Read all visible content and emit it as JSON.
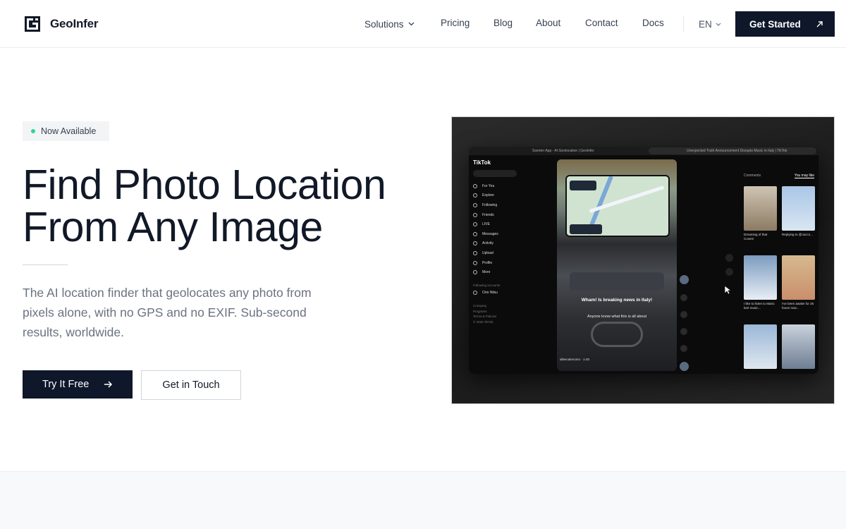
{
  "brand": {
    "name": "GeoInfer"
  },
  "nav": {
    "links": [
      {
        "label": "Solutions",
        "has_menu": true
      },
      {
        "label": "Pricing"
      },
      {
        "label": "Blog"
      },
      {
        "label": "About"
      },
      {
        "label": "Contact"
      },
      {
        "label": "Docs"
      }
    ],
    "language": "EN",
    "cta_label": "Get Started"
  },
  "hero": {
    "badge": "Now Available",
    "title_line1": "Find Photo Location",
    "title_line2": "From Any Image",
    "subtitle": "The AI location finder that geolocates any photo from pixels alone, with no GPS and no EXIF. Sub-second results, worldwide.",
    "primary_label": "Try It Free",
    "secondary_label": "Get in Touch"
  },
  "screenshot": {
    "tab1": "Ssenter App - AI Geolocation | GeoInfer",
    "tab2": "Unexpected Truth Announcement Disrupts Music in Italy | TikTok",
    "logo": "TikTok",
    "sidebar": [
      "For You",
      "Explore",
      "Following",
      "Friends",
      "LIVE",
      "Messages",
      "Activity",
      "Upload",
      "Profile",
      "More"
    ],
    "following_label": "Following accounts",
    "following_user": "Orio Nilsu",
    "footer_links": [
      "Company",
      "Programs",
      "Terms & Policies",
      "© 2025 TikTok"
    ],
    "caption_main": "Wham! Is breaking news in Italy!",
    "caption_sub": "Anyone know what this is all about",
    "video_user": "alleecalenomo · 1-20",
    "panel_tabs": [
      "Comments",
      "You may like"
    ],
    "thumb_captions": [
      "Dreaming of that Coven!",
      "Replying to @Jucco...",
      "I like to listen to Mario kart music...",
      "I've been awake for 26 hours now..."
    ],
    "colors": {
      "accent_dark": "#0f172a",
      "badge_dot": "#34d399"
    }
  }
}
